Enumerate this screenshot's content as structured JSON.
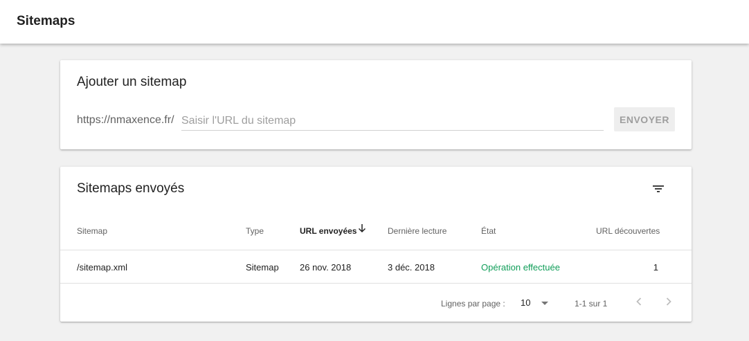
{
  "header": {
    "title": "Sitemaps"
  },
  "add_sitemap": {
    "title": "Ajouter un sitemap",
    "url_prefix": "https://nmaxence.fr/",
    "input_value": "",
    "input_placeholder": "Saisir l'URL du sitemap",
    "submit_label": "ENVOYER"
  },
  "submitted": {
    "title": "Sitemaps envoyés",
    "columns": {
      "sitemap": "Sitemap",
      "type": "Type",
      "urls_submitted": "URL envoyées",
      "last_read": "Dernière lecture",
      "status": "État",
      "urls_discovered": "URL découvertes"
    },
    "rows": [
      {
        "sitemap": "/sitemap.xml",
        "type": "Sitemap",
        "urls_submitted": "26 nov. 2018",
        "last_read": "3 déc. 2018",
        "status": "Opération effectuée",
        "urls_discovered": "1"
      }
    ],
    "pagination": {
      "rows_per_page_label": "Lignes par page :",
      "rows_per_page_value": "10",
      "range": "1-1 sur 1"
    }
  },
  "colors": {
    "status_success": "#0f9d58",
    "background": "#f1f1f1",
    "button_disabled_bg": "#eeeeee"
  },
  "icons": {
    "filter": "filter-icon",
    "sort": "arrow-down-icon",
    "caret": "caret-down-icon",
    "prev": "chevron-left-icon",
    "next": "chevron-right-icon"
  }
}
